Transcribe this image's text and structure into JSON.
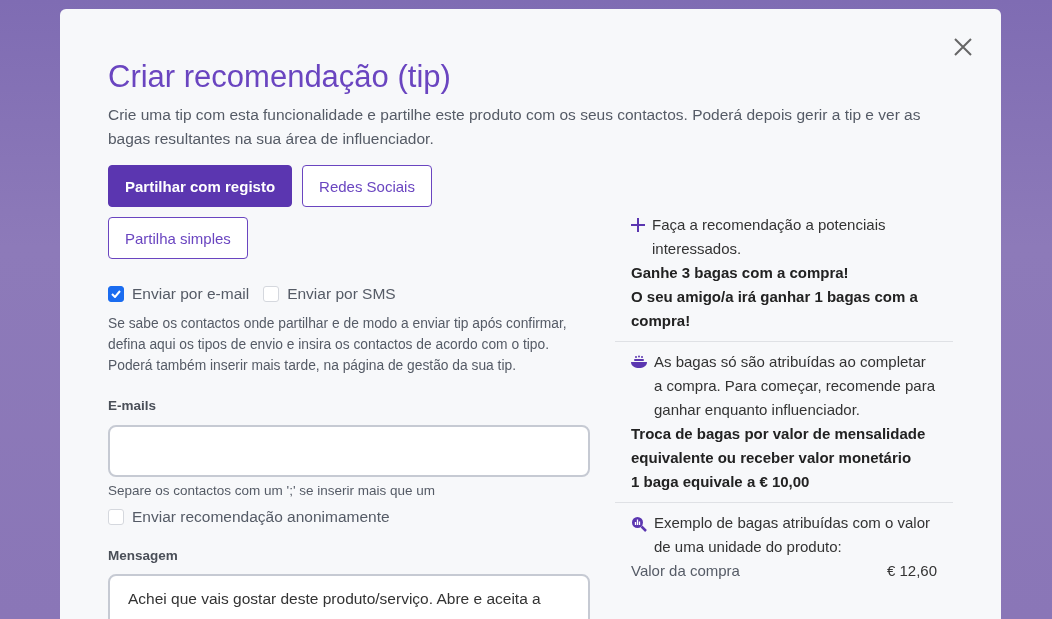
{
  "dialog": {
    "title": "Criar recomendação (tip)",
    "description": "Crie uma tip com esta funcionalidade e partilhe este produto com os seus contactos. Poderá depois gerir a tip e ver as bagas resultantes na sua área de influenciador.",
    "share_modes": [
      {
        "label": "Partilhar com registo",
        "selected": true
      },
      {
        "label": "Redes Sociais",
        "selected": false
      },
      {
        "label": "Partilha simples",
        "selected": false
      }
    ],
    "send_options": [
      {
        "label": "Enviar por e-mail",
        "checked": true
      },
      {
        "label": "Enviar por SMS",
        "checked": false
      }
    ],
    "send_help": "Se sabe os contactos onde partilhar e de modo a enviar tip após confirmar, defina aqui os tipos de envio e insira os contactos de acordo com o tipo. Poderá também inserir mais tarde, na página de gestão da sua tip.",
    "emails": {
      "label": "E-mails",
      "help": "Separe os contactos com um ';' se inserir mais que um"
    },
    "anonymous": {
      "label": "Enviar recomendação anonimamente",
      "checked": false
    },
    "message": {
      "label": "Mensagem",
      "value": "Achei que vais gostar deste produto/serviço. Abre e aceita a"
    },
    "info_sections": [
      {
        "kind": "plus",
        "lines": [
          {
            "text": "Faça a recomendação a potenciais interessados.",
            "bold": false
          },
          {
            "text": "Ganhe 3 bagas com a compra!",
            "bold": true
          },
          {
            "text": "O seu amigo/a irá ganhar 1 bagas com a compra!",
            "bold": true
          }
        ]
      },
      {
        "kind": "bowl",
        "lines": [
          {
            "text": "As bagas só são atribuídas ao completar a compra. Para começar, recomende para ganhar enquanto influenciador.",
            "bold": false
          },
          {
            "text": "Troca de bagas por valor de mensalidade equivalente ou receber valor monetário",
            "bold": true
          },
          {
            "text": "1 baga equivale a € 10,00",
            "bold": true
          }
        ]
      },
      {
        "kind": "chart",
        "lines": [
          {
            "text": "Exemplo de bagas atribuídas com o valor de uma unidade do produto:",
            "bold": false
          }
        ],
        "rows": [
          {
            "label": "Valor da compra",
            "value": "€ 12,60"
          }
        ]
      }
    ]
  }
}
